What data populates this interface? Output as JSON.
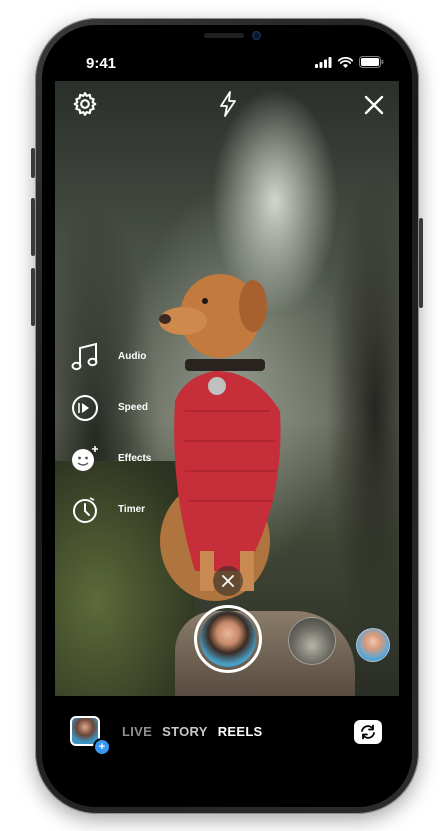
{
  "status_bar": {
    "time": "9:41"
  },
  "camera": {
    "settings_icon": "gear-icon",
    "flash_icon": "lightning-bolt-icon",
    "close_icon": "close-icon"
  },
  "tools": [
    {
      "label": "Audio",
      "icon": "music-note-icon"
    },
    {
      "label": "Speed",
      "icon": "speed-icon"
    },
    {
      "label": "Effects",
      "icon": "effects-face-icon"
    },
    {
      "label": "Timer",
      "icon": "timer-icon"
    }
  ],
  "modes": {
    "live": "LIVE",
    "story": "STORY",
    "reels": "REELS",
    "selected": "REELS"
  },
  "colors": {
    "accent_blue": "#3897f0",
    "text_white": "#ffffff",
    "inactive_gray": "#8e8e93"
  }
}
